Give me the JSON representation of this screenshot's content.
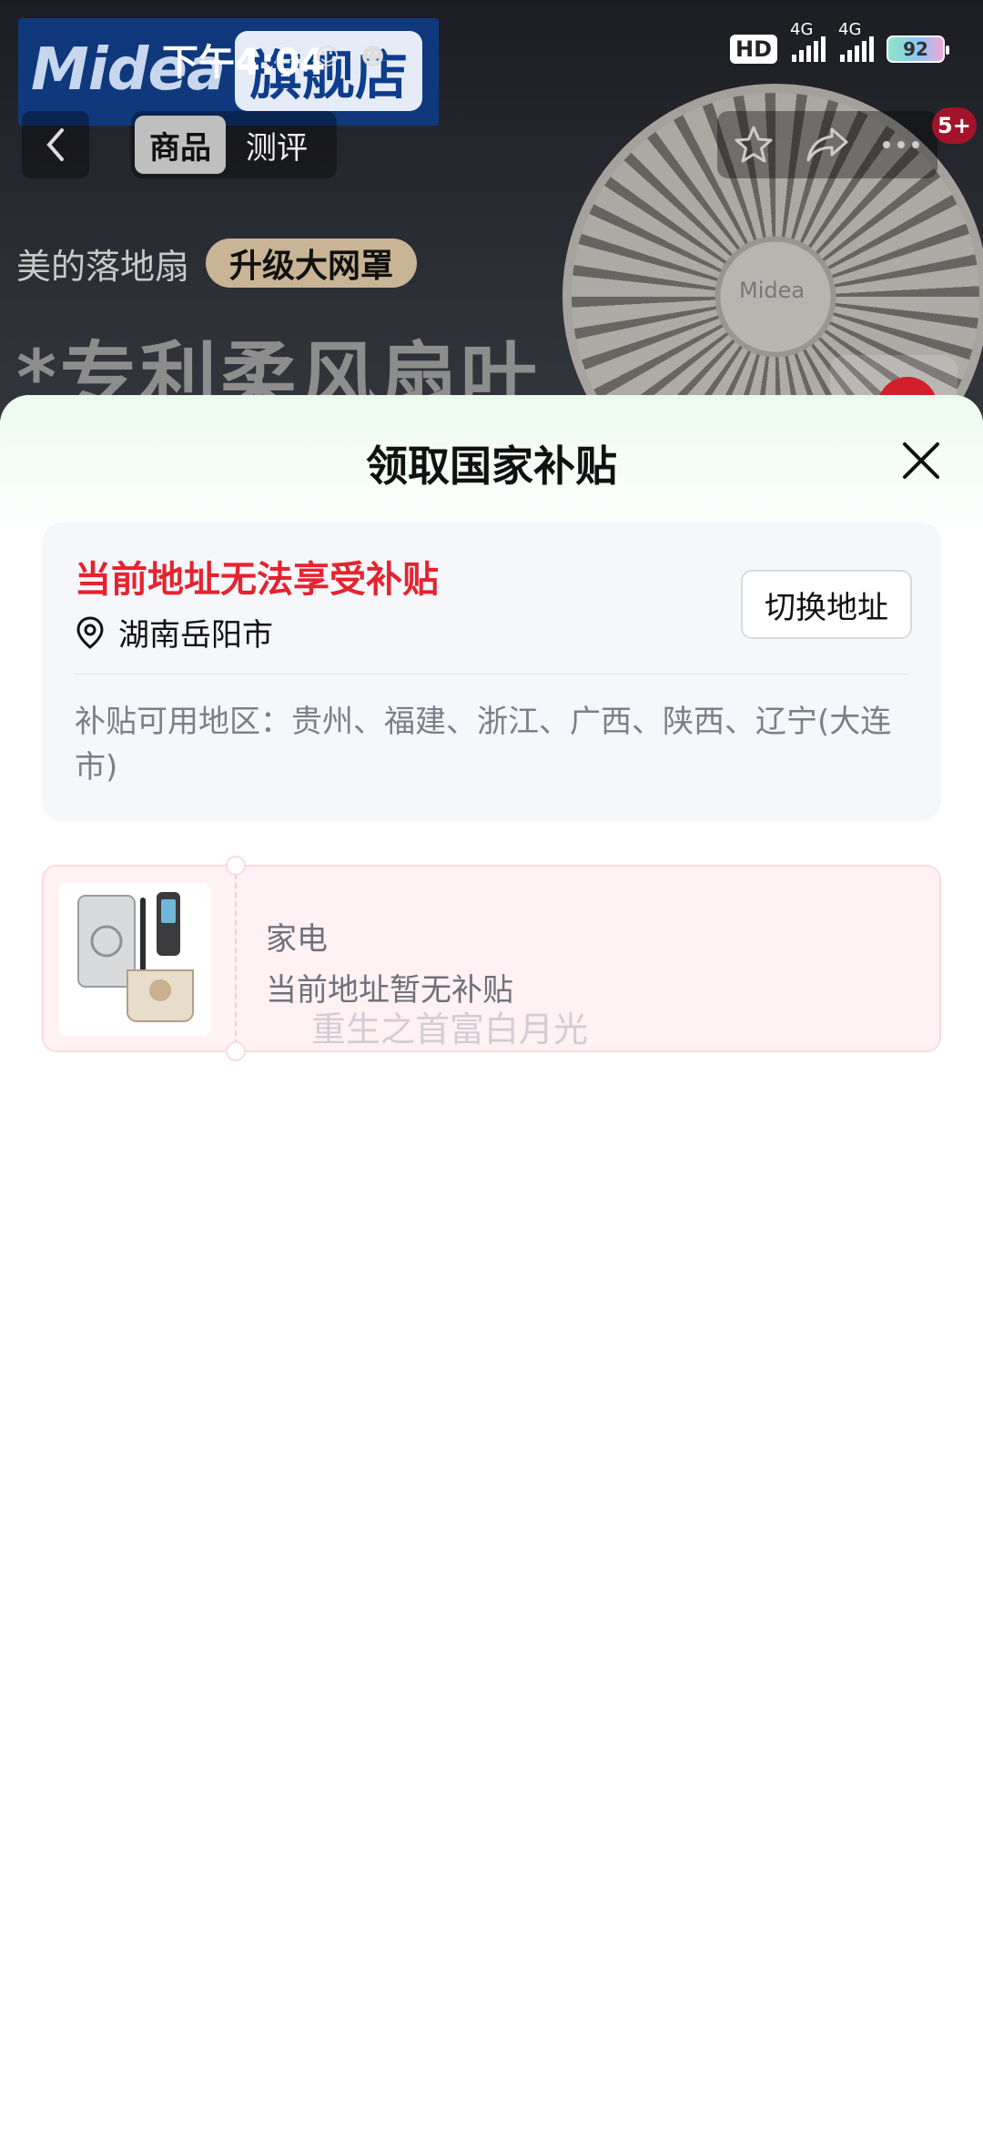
{
  "status_bar": {
    "time": "下午4:04",
    "hd_label": "HD",
    "network_1": "4G",
    "network_2": "4G",
    "battery": "92"
  },
  "background_page": {
    "brand_logo": "Midea",
    "brand_store": "旗舰店",
    "nav_tabs": [
      {
        "label": "商品",
        "active": true
      },
      {
        "label": "测评",
        "active": false
      }
    ],
    "message_badge": "5+",
    "product_subtitle": "美的落地扇",
    "product_tag": "升级大网罩",
    "product_headline": "*专利柔风扇叶",
    "fan_logo": "Midea"
  },
  "sheet": {
    "title": "领取国家补贴",
    "address_card": {
      "warning": "当前地址无法享受补贴",
      "city": "湖南岳阳市",
      "switch_button": "切换地址",
      "regions": "补贴可用地区：贵州、福建、浙江、广西、陕西、辽宁(大连市)"
    },
    "coupon": {
      "category": "家电",
      "status": "当前地址暂无补贴"
    },
    "watermark": "重生之首富白月光"
  },
  "colors": {
    "warning_red": "#e5232f",
    "sheet_header_tint": "#ecfbef",
    "coupon_bg": "#fff1f4"
  }
}
